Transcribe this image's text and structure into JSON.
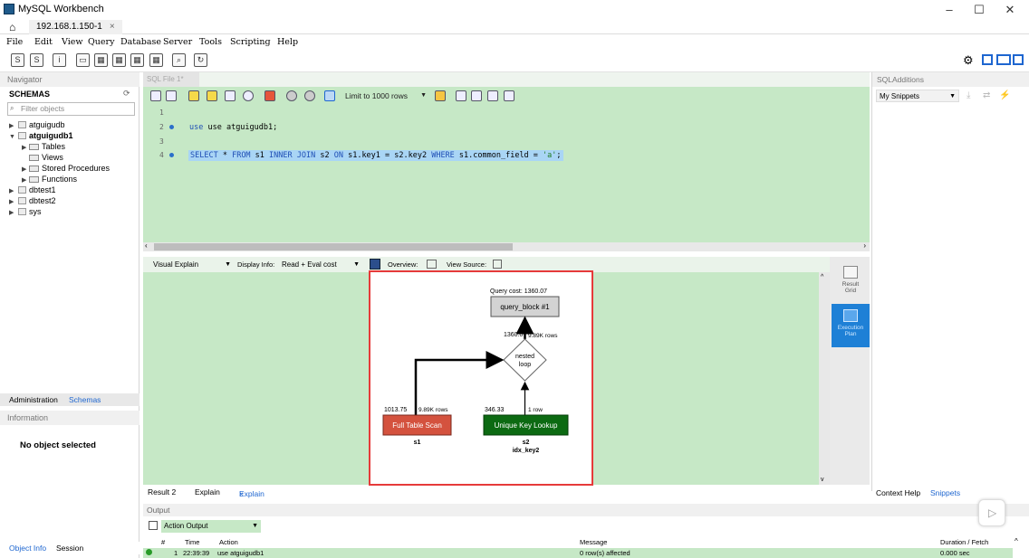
{
  "window": {
    "title": "MySQL Workbench",
    "minimize": "–",
    "maximize": "☐",
    "close": "✕"
  },
  "tabs": {
    "home_icon": "home-icon",
    "connection": "192.168.1.150-1",
    "close": "×"
  },
  "menu": [
    "File",
    "Edit",
    "View",
    "Query",
    "Database",
    "Server",
    "Tools",
    "Scripting",
    "Help"
  ],
  "navigator": {
    "header": "Navigator",
    "schemas_label": "SCHEMAS",
    "filter_placeholder": "Filter objects",
    "tree": {
      "atguigudb": "atguigudb",
      "atguigudb1": "atguigudb1",
      "tables": "Tables",
      "views": "Views",
      "procedures": "Stored Procedures",
      "functions": "Functions",
      "dbtest1": "dbtest1",
      "dbtest2": "dbtest2",
      "sys": "sys"
    },
    "tab_admin": "Administration",
    "tab_schemas": "Schemas",
    "info_header": "Information",
    "no_object": "No object selected",
    "tab_object_info": "Object Info",
    "tab_session": "Session"
  },
  "editor": {
    "tab_label": "SQL File 1*",
    "limit_label": "Limit to 1000 rows",
    "line_numbers": [
      "1",
      "2",
      "3",
      "4"
    ],
    "line2": "use atguigudb1;",
    "line4": {
      "select": "SELECT",
      "star": " * ",
      "from": "FROM",
      "s1": " s1 ",
      "inner_join": "INNER JOIN",
      "s2": " s2 ",
      "on": "ON",
      "cond": " s1.key1 = s2.key2 ",
      "where": "WHERE",
      "where_field": " s1.common_field = ",
      "literal": "'a'",
      "end": ";"
    }
  },
  "explain": {
    "mode": "Visual Explain",
    "display_info_label": "Display Info:",
    "display_info_value": "Read + Eval cost",
    "overview_label": "Overview:",
    "view_source_label": "View Source:",
    "diagram": {
      "query_cost": "Query cost: 1360.07",
      "query_block": "query_block #1",
      "nested_cost": "1360.07",
      "nested_rows": "9.89K rows",
      "nested_label_1": "nested",
      "nested_label_2": "loop",
      "left_cost": "1013.75",
      "left_rows": "9.89K rows",
      "left_op": "Full Table Scan",
      "left_table": "s1",
      "right_cost": "346.33",
      "right_rows": "1 row",
      "right_op": "Unique Key Lookup",
      "right_table": "s2",
      "right_key": "idx_key2"
    },
    "side_result_grid_1": "Result",
    "side_result_grid_2": "Grid",
    "side_exec_plan_1": "Execution",
    "side_exec_plan_2": "Plan"
  },
  "result_tabs": {
    "result2": "Result 2",
    "explain1": "Explain",
    "explain2": "Explain",
    "close": "×"
  },
  "output": {
    "header": "Output",
    "dropdown": "Action Output",
    "columns": {
      "num": "#",
      "time": "Time",
      "action": "Action",
      "message": "Message",
      "duration": "Duration / Fetch"
    },
    "row": {
      "num": "1",
      "time": "22:39:39",
      "action": "use atguigudb1",
      "message": "0 row(s) affected",
      "duration": "0.000 sec"
    }
  },
  "sql_additions": {
    "header": "SQLAdditions",
    "snippets_dropdown": "My Snippets",
    "tab_context_help": "Context Help",
    "tab_snippets": "Snippets"
  },
  "colors": {
    "editor_bg": "#c6e8c6",
    "full_scan": "#d4523e",
    "unique_lookup": "#0c6a12",
    "highlight_border": "#e63a3a",
    "active_blue": "#1e80d6"
  }
}
